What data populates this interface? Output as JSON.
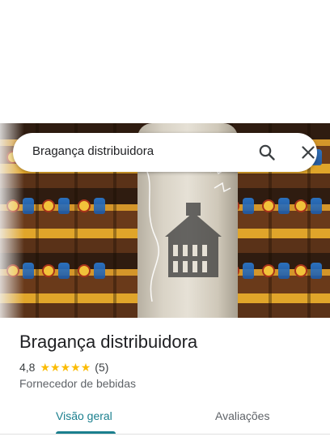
{
  "search": {
    "query": "Bragança distribuidora"
  },
  "place": {
    "name": "Bragança distribuidora",
    "rating": "4,8",
    "stars": 5,
    "review_count": "(5)",
    "category": "Fornecedor de bebidas"
  },
  "tabs": [
    {
      "label": "Visão geral",
      "active": true
    },
    {
      "label": "Avaliações",
      "active": false
    }
  ],
  "colors": {
    "accent": "#1a7f8e",
    "star": "#fbbc04"
  },
  "icons": {
    "search": "search-icon",
    "close": "close-icon"
  }
}
